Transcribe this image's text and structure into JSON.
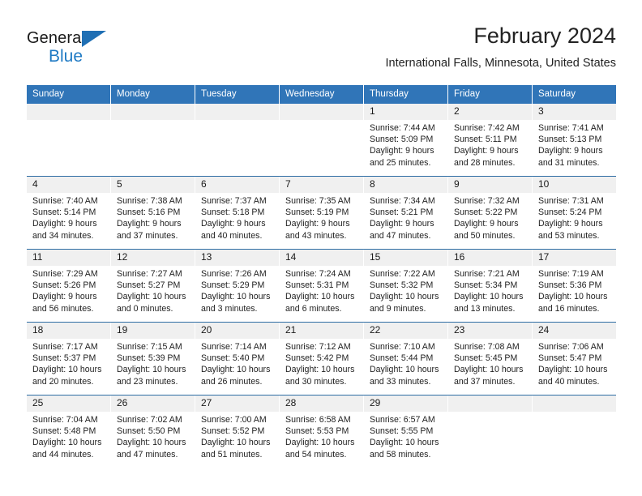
{
  "brand": {
    "name_top": "General",
    "name_bottom": "Blue"
  },
  "header": {
    "title": "February 2024",
    "subtitle": "International Falls, Minnesota, United States"
  },
  "colors": {
    "header_blue": "#3075b8",
    "row_divider_blue": "#2e6da4",
    "day_number_bg": "#f0f0f0",
    "brand_blue": "#1f7ac4"
  },
  "weekdays": [
    "Sunday",
    "Monday",
    "Tuesday",
    "Wednesday",
    "Thursday",
    "Friday",
    "Saturday"
  ],
  "weeks": [
    [
      {
        "day": "",
        "sunrise": "",
        "sunset": "",
        "daylight1": "",
        "daylight2": ""
      },
      {
        "day": "",
        "sunrise": "",
        "sunset": "",
        "daylight1": "",
        "daylight2": ""
      },
      {
        "day": "",
        "sunrise": "",
        "sunset": "",
        "daylight1": "",
        "daylight2": ""
      },
      {
        "day": "",
        "sunrise": "",
        "sunset": "",
        "daylight1": "",
        "daylight2": ""
      },
      {
        "day": "1",
        "sunrise": "Sunrise: 7:44 AM",
        "sunset": "Sunset: 5:09 PM",
        "daylight1": "Daylight: 9 hours",
        "daylight2": "and 25 minutes."
      },
      {
        "day": "2",
        "sunrise": "Sunrise: 7:42 AM",
        "sunset": "Sunset: 5:11 PM",
        "daylight1": "Daylight: 9 hours",
        "daylight2": "and 28 minutes."
      },
      {
        "day": "3",
        "sunrise": "Sunrise: 7:41 AM",
        "sunset": "Sunset: 5:13 PM",
        "daylight1": "Daylight: 9 hours",
        "daylight2": "and 31 minutes."
      }
    ],
    [
      {
        "day": "4",
        "sunrise": "Sunrise: 7:40 AM",
        "sunset": "Sunset: 5:14 PM",
        "daylight1": "Daylight: 9 hours",
        "daylight2": "and 34 minutes."
      },
      {
        "day": "5",
        "sunrise": "Sunrise: 7:38 AM",
        "sunset": "Sunset: 5:16 PM",
        "daylight1": "Daylight: 9 hours",
        "daylight2": "and 37 minutes."
      },
      {
        "day": "6",
        "sunrise": "Sunrise: 7:37 AM",
        "sunset": "Sunset: 5:18 PM",
        "daylight1": "Daylight: 9 hours",
        "daylight2": "and 40 minutes."
      },
      {
        "day": "7",
        "sunrise": "Sunrise: 7:35 AM",
        "sunset": "Sunset: 5:19 PM",
        "daylight1": "Daylight: 9 hours",
        "daylight2": "and 43 minutes."
      },
      {
        "day": "8",
        "sunrise": "Sunrise: 7:34 AM",
        "sunset": "Sunset: 5:21 PM",
        "daylight1": "Daylight: 9 hours",
        "daylight2": "and 47 minutes."
      },
      {
        "day": "9",
        "sunrise": "Sunrise: 7:32 AM",
        "sunset": "Sunset: 5:22 PM",
        "daylight1": "Daylight: 9 hours",
        "daylight2": "and 50 minutes."
      },
      {
        "day": "10",
        "sunrise": "Sunrise: 7:31 AM",
        "sunset": "Sunset: 5:24 PM",
        "daylight1": "Daylight: 9 hours",
        "daylight2": "and 53 minutes."
      }
    ],
    [
      {
        "day": "11",
        "sunrise": "Sunrise: 7:29 AM",
        "sunset": "Sunset: 5:26 PM",
        "daylight1": "Daylight: 9 hours",
        "daylight2": "and 56 minutes."
      },
      {
        "day": "12",
        "sunrise": "Sunrise: 7:27 AM",
        "sunset": "Sunset: 5:27 PM",
        "daylight1": "Daylight: 10 hours",
        "daylight2": "and 0 minutes."
      },
      {
        "day": "13",
        "sunrise": "Sunrise: 7:26 AM",
        "sunset": "Sunset: 5:29 PM",
        "daylight1": "Daylight: 10 hours",
        "daylight2": "and 3 minutes."
      },
      {
        "day": "14",
        "sunrise": "Sunrise: 7:24 AM",
        "sunset": "Sunset: 5:31 PM",
        "daylight1": "Daylight: 10 hours",
        "daylight2": "and 6 minutes."
      },
      {
        "day": "15",
        "sunrise": "Sunrise: 7:22 AM",
        "sunset": "Sunset: 5:32 PM",
        "daylight1": "Daylight: 10 hours",
        "daylight2": "and 9 minutes."
      },
      {
        "day": "16",
        "sunrise": "Sunrise: 7:21 AM",
        "sunset": "Sunset: 5:34 PM",
        "daylight1": "Daylight: 10 hours",
        "daylight2": "and 13 minutes."
      },
      {
        "day": "17",
        "sunrise": "Sunrise: 7:19 AM",
        "sunset": "Sunset: 5:36 PM",
        "daylight1": "Daylight: 10 hours",
        "daylight2": "and 16 minutes."
      }
    ],
    [
      {
        "day": "18",
        "sunrise": "Sunrise: 7:17 AM",
        "sunset": "Sunset: 5:37 PM",
        "daylight1": "Daylight: 10 hours",
        "daylight2": "and 20 minutes."
      },
      {
        "day": "19",
        "sunrise": "Sunrise: 7:15 AM",
        "sunset": "Sunset: 5:39 PM",
        "daylight1": "Daylight: 10 hours",
        "daylight2": "and 23 minutes."
      },
      {
        "day": "20",
        "sunrise": "Sunrise: 7:14 AM",
        "sunset": "Sunset: 5:40 PM",
        "daylight1": "Daylight: 10 hours",
        "daylight2": "and 26 minutes."
      },
      {
        "day": "21",
        "sunrise": "Sunrise: 7:12 AM",
        "sunset": "Sunset: 5:42 PM",
        "daylight1": "Daylight: 10 hours",
        "daylight2": "and 30 minutes."
      },
      {
        "day": "22",
        "sunrise": "Sunrise: 7:10 AM",
        "sunset": "Sunset: 5:44 PM",
        "daylight1": "Daylight: 10 hours",
        "daylight2": "and 33 minutes."
      },
      {
        "day": "23",
        "sunrise": "Sunrise: 7:08 AM",
        "sunset": "Sunset: 5:45 PM",
        "daylight1": "Daylight: 10 hours",
        "daylight2": "and 37 minutes."
      },
      {
        "day": "24",
        "sunrise": "Sunrise: 7:06 AM",
        "sunset": "Sunset: 5:47 PM",
        "daylight1": "Daylight: 10 hours",
        "daylight2": "and 40 minutes."
      }
    ],
    [
      {
        "day": "25",
        "sunrise": "Sunrise: 7:04 AM",
        "sunset": "Sunset: 5:48 PM",
        "daylight1": "Daylight: 10 hours",
        "daylight2": "and 44 minutes."
      },
      {
        "day": "26",
        "sunrise": "Sunrise: 7:02 AM",
        "sunset": "Sunset: 5:50 PM",
        "daylight1": "Daylight: 10 hours",
        "daylight2": "and 47 minutes."
      },
      {
        "day": "27",
        "sunrise": "Sunrise: 7:00 AM",
        "sunset": "Sunset: 5:52 PM",
        "daylight1": "Daylight: 10 hours",
        "daylight2": "and 51 minutes."
      },
      {
        "day": "28",
        "sunrise": "Sunrise: 6:58 AM",
        "sunset": "Sunset: 5:53 PM",
        "daylight1": "Daylight: 10 hours",
        "daylight2": "and 54 minutes."
      },
      {
        "day": "29",
        "sunrise": "Sunrise: 6:57 AM",
        "sunset": "Sunset: 5:55 PM",
        "daylight1": "Daylight: 10 hours",
        "daylight2": "and 58 minutes."
      },
      {
        "day": "",
        "sunrise": "",
        "sunset": "",
        "daylight1": "",
        "daylight2": ""
      },
      {
        "day": "",
        "sunrise": "",
        "sunset": "",
        "daylight1": "",
        "daylight2": ""
      }
    ]
  ]
}
